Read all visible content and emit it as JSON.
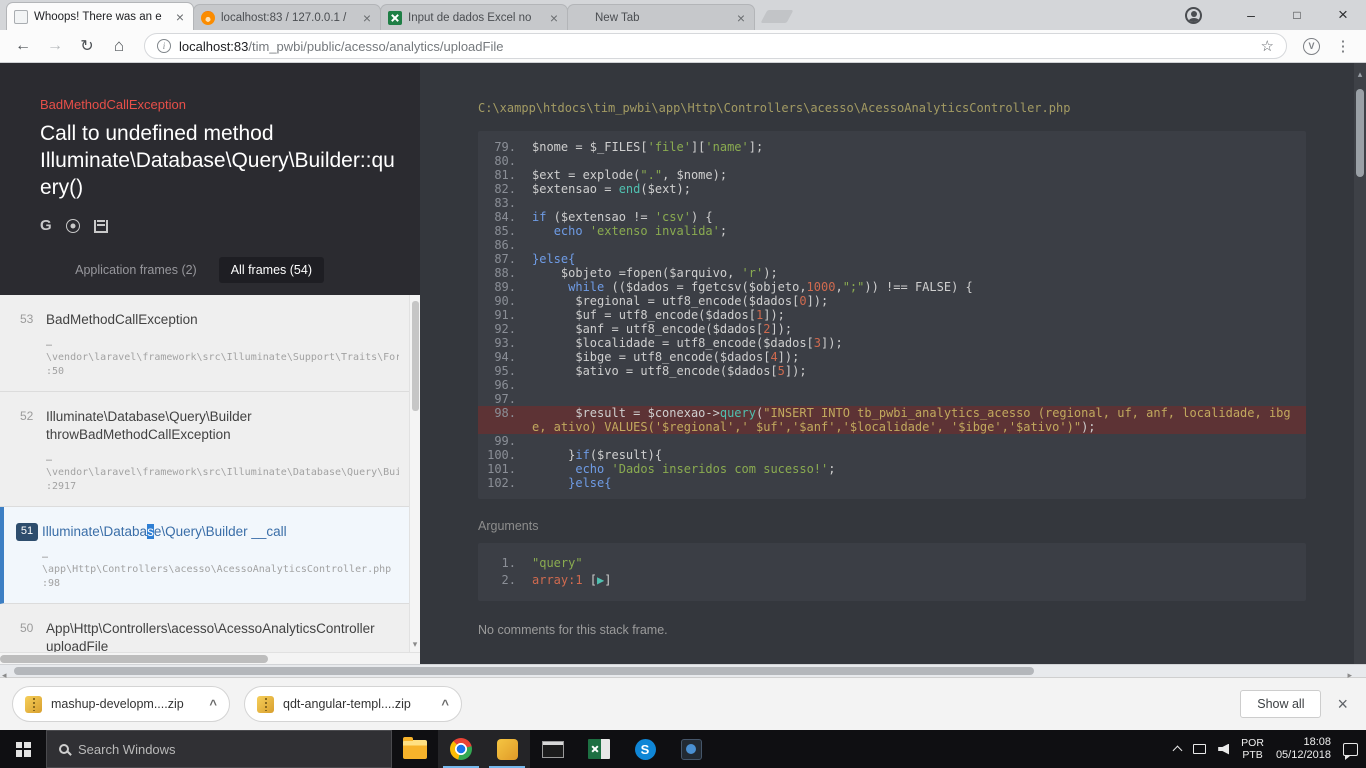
{
  "browser": {
    "tabs": [
      {
        "title": "Whoops! There was an e",
        "icon": "page",
        "active": true
      },
      {
        "title": "localhost:83 / 127.0.0.1 /",
        "icon": "xampp",
        "active": false
      },
      {
        "title": "Input de dados Excel no",
        "icon": "excel",
        "active": false
      },
      {
        "title": "New Tab",
        "icon": "none",
        "active": false
      }
    ],
    "url_host": "localhost:83",
    "url_path": "/tim_pwbi/public/acesso/analytics/uploadFile"
  },
  "whoops": {
    "exception_class": "BadMethodCallException",
    "message": "Call to undefined method Illuminate\\Database\\Query\\Builder::query()",
    "frame_tabs": {
      "application": "Application frames (2)",
      "all": "All frames (54)"
    },
    "frames": [
      {
        "num": "53",
        "title": "BadMethodCallException",
        "subtitle": "",
        "dots": "…",
        "path": "\\vendor\\laravel\\framework\\src\\Illuminate\\Support\\Traits\\Forwa",
        "line": ":50",
        "selected": false
      },
      {
        "num": "52",
        "title": "Illuminate\\Database\\Query\\Builder",
        "subtitle": "throwBadMethodCallException",
        "dots": "…",
        "path": "\\vendor\\laravel\\framework\\src\\Illuminate\\Database\\Query\\Build",
        "line": ":2917",
        "selected": false
      },
      {
        "num": "51",
        "title_pre": "Illuminate\\Databa",
        "title_sel": "s",
        "title_post": "e\\Query\\Builder __call",
        "subtitle": "",
        "dots": "…",
        "path": "\\app\\Http\\Controllers\\acesso\\AcessoAnalyticsController.php",
        "line": ":98",
        "selected": true
      },
      {
        "num": "50",
        "title": "App\\Http\\Controllers\\acesso\\AcessoAnalyticsController",
        "subtitle": "uploadFile",
        "dots": "…",
        "path": "",
        "line": "",
        "selected": false
      }
    ],
    "code": {
      "file_path": "C:\\xampp\\htdocs\\tim_pwbi\\app\\Http\\Controllers\\acesso\\AcessoAnalyticsController.php",
      "lines": [
        {
          "n": "79.",
          "t": [
            [
              "d",
              "$nome = $_FILES["
            ],
            [
              "s",
              "'file'"
            ],
            [
              "d",
              "]["
            ],
            [
              "s",
              "'name'"
            ],
            [
              "d",
              "];"
            ]
          ]
        },
        {
          "n": "80.",
          "t": []
        },
        {
          "n": "81.",
          "t": [
            [
              "d",
              "$ext = explode("
            ],
            [
              "s",
              "\".\""
            ],
            [
              "d",
              ", $nome);"
            ]
          ]
        },
        {
          "n": "82.",
          "t": [
            [
              "d",
              "$extensao = "
            ],
            [
              "f",
              "end"
            ],
            [
              "d",
              "($ext);"
            ]
          ]
        },
        {
          "n": "83.",
          "t": []
        },
        {
          "n": "84.",
          "t": [
            [
              "k",
              "if"
            ],
            [
              "d",
              " ($extensao != "
            ],
            [
              "s",
              "'csv'"
            ],
            [
              "d",
              ") {"
            ]
          ]
        },
        {
          "n": "85.",
          "t": [
            [
              "d",
              "   "
            ],
            [
              "k",
              "echo"
            ],
            [
              "d",
              " "
            ],
            [
              "s",
              "'extenso invalida'"
            ],
            [
              "d",
              ";"
            ]
          ]
        },
        {
          "n": "86.",
          "t": []
        },
        {
          "n": "87.",
          "t": [
            [
              "k",
              "}else{"
            ]
          ]
        },
        {
          "n": "88.",
          "t": [
            [
              "d",
              "    $objeto =fopen($arquivo, "
            ],
            [
              "s",
              "'r'"
            ],
            [
              "d",
              ");"
            ]
          ]
        },
        {
          "n": "89.",
          "t": [
            [
              "d",
              "     "
            ],
            [
              "k",
              "while"
            ],
            [
              "d",
              " (($dados = fgetcsv($objeto,"
            ],
            [
              "n",
              "1000"
            ],
            [
              "d",
              ","
            ],
            [
              "s",
              "\";\""
            ],
            [
              "d",
              ")) !== FALSE) {"
            ]
          ]
        },
        {
          "n": "90.",
          "t": [
            [
              "d",
              "      $regional = utf8_encode($dados["
            ],
            [
              "n",
              "0"
            ],
            [
              "d",
              "]);"
            ]
          ]
        },
        {
          "n": "91.",
          "t": [
            [
              "d",
              "      $uf = utf8_encode($dados["
            ],
            [
              "n",
              "1"
            ],
            [
              "d",
              "]);"
            ]
          ]
        },
        {
          "n": "92.",
          "t": [
            [
              "d",
              "      $anf = utf8_encode($dados["
            ],
            [
              "n",
              "2"
            ],
            [
              "d",
              "]);"
            ]
          ]
        },
        {
          "n": "93.",
          "t": [
            [
              "d",
              "      $localidade = utf8_encode($dados["
            ],
            [
              "n",
              "3"
            ],
            [
              "d",
              "]);"
            ]
          ]
        },
        {
          "n": "94.",
          "t": [
            [
              "d",
              "      $ibge = utf8_encode($dados["
            ],
            [
              "n",
              "4"
            ],
            [
              "d",
              "]);"
            ]
          ]
        },
        {
          "n": "95.",
          "t": [
            [
              "d",
              "      $ativo = utf8_encode($dados["
            ],
            [
              "n",
              "5"
            ],
            [
              "d",
              "]);"
            ]
          ]
        },
        {
          "n": "96.",
          "t": []
        },
        {
          "n": "97.",
          "t": []
        },
        {
          "n": "98.",
          "hl": true,
          "t": [
            [
              "d",
              "      $result = $conexao->"
            ],
            [
              "f",
              "query"
            ],
            [
              "d",
              "("
            ],
            [
              "y",
              "\"INSERT INTO tb_pwbi_analytics_acesso (regional, uf, anf, localidade, ibge, ativo) VALUES('$regional',' $uf','$anf','$localidade', '$ibge','$ativo')\""
            ],
            [
              "d",
              ");"
            ]
          ]
        },
        {
          "n": "99.",
          "t": []
        },
        {
          "n": "100.",
          "t": [
            [
              "d",
              "     }"
            ],
            [
              "k",
              "if"
            ],
            [
              "d",
              "($result){"
            ]
          ]
        },
        {
          "n": "101.",
          "t": [
            [
              "d",
              "      "
            ],
            [
              "k",
              "echo"
            ],
            [
              "d",
              " "
            ],
            [
              "s",
              "'Dados inseridos com sucesso!'"
            ],
            [
              "d",
              ";"
            ]
          ]
        },
        {
          "n": "102.",
          "t": [
            [
              "d",
              "     "
            ],
            [
              "k",
              "}else{"
            ]
          ]
        }
      ]
    },
    "args": {
      "label": "Arguments",
      "items": [
        {
          "num": "1.",
          "tokens": [
            [
              "s",
              "\"query\""
            ]
          ]
        },
        {
          "num": "2.",
          "tokens": [
            [
              "n",
              "array:1"
            ],
            [
              "d",
              " ["
            ],
            [
              "tri",
              "▶"
            ],
            [
              "d",
              "]"
            ]
          ]
        }
      ]
    },
    "comments": "No comments for this stack frame."
  },
  "downloads": {
    "items": [
      {
        "name": "mashup-developm....zip"
      },
      {
        "name": "qdt-angular-templ....zip"
      }
    ],
    "show_all": "Show all"
  },
  "taskbar": {
    "search_placeholder": "Search Windows",
    "icons": [
      {
        "name": "file-explorer",
        "open": false
      },
      {
        "name": "chrome",
        "open": true
      },
      {
        "name": "editor",
        "open": true
      },
      {
        "name": "terminal",
        "open": false
      },
      {
        "name": "excel",
        "open": false
      },
      {
        "name": "skype",
        "open": false
      },
      {
        "name": "photos",
        "open": false
      }
    ],
    "tray": {
      "lang_top": "POR",
      "lang_bottom": "PTB",
      "time": "18:08",
      "date": "05/12/2018"
    }
  }
}
